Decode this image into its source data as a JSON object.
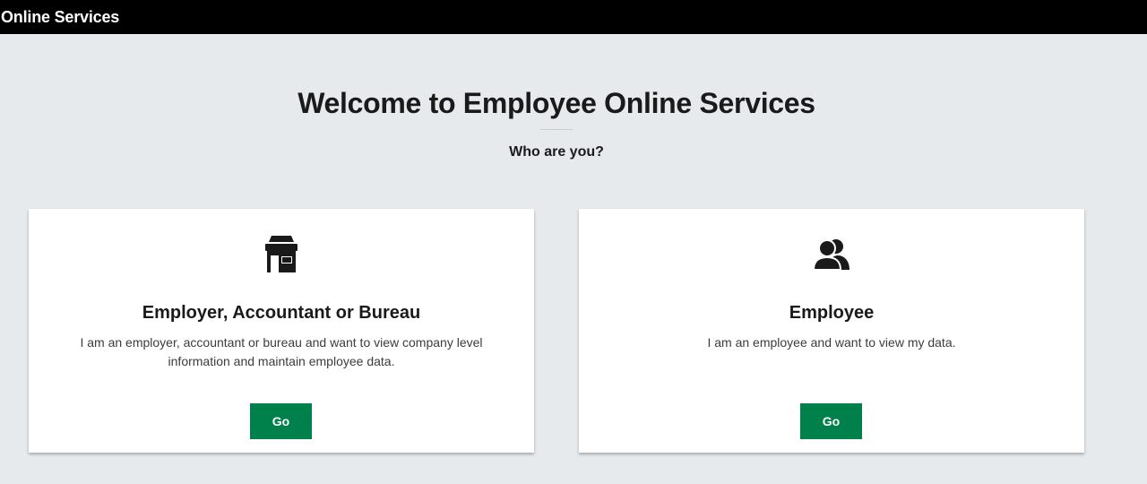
{
  "header": {
    "title": "Online Services"
  },
  "hero": {
    "title": "Welcome to Employee Online Services",
    "subtitle": "Who are you?"
  },
  "cards": [
    {
      "icon": "storefront-icon",
      "title": "Employer, Accountant or Bureau",
      "description": "I am an employer, accountant or bureau and want to view company level information and maintain employee data.",
      "button_label": "Go"
    },
    {
      "icon": "people-icon",
      "title": "Employee",
      "description": "I am an employee and want to view my data.",
      "button_label": "Go"
    }
  ],
  "colors": {
    "header_bg": "#000000",
    "page_bg": "#e6eaec",
    "button_bg": "#00804a",
    "text": "#1a1a1a"
  }
}
